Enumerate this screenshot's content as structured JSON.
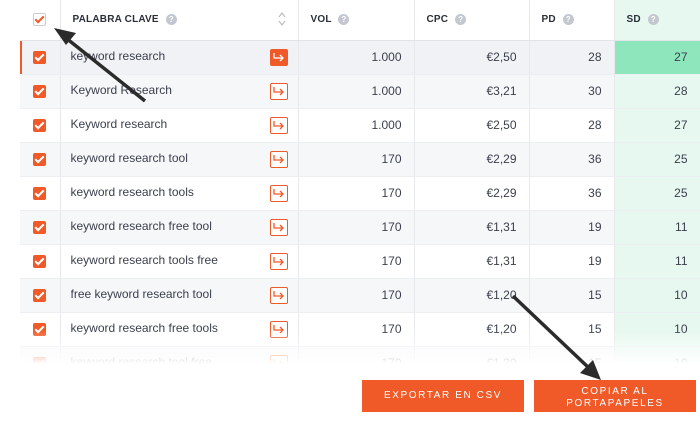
{
  "colors": {
    "accent": "#f05a28",
    "sd_highlight": "#8ee6bd",
    "sd_column": "#e6f8ef"
  },
  "table": {
    "headers": {
      "keyword": "PALABRA CLAVE",
      "vol": "VOL",
      "cpc": "CPC",
      "pd": "PD",
      "sd": "SD"
    },
    "rows": [
      {
        "keyword": "keyword research",
        "vol": "1.000",
        "cpc": "€2,50",
        "pd": "28",
        "sd": "27"
      },
      {
        "keyword": "Keyword Research",
        "vol": "1.000",
        "cpc": "€3,21",
        "pd": "30",
        "sd": "28"
      },
      {
        "keyword": "Keyword research",
        "vol": "1.000",
        "cpc": "€2,50",
        "pd": "28",
        "sd": "27"
      },
      {
        "keyword": "keyword research tool",
        "vol": "170",
        "cpc": "€2,29",
        "pd": "36",
        "sd": "25"
      },
      {
        "keyword": "keyword research tools",
        "vol": "170",
        "cpc": "€2,29",
        "pd": "36",
        "sd": "25"
      },
      {
        "keyword": "keyword research free tool",
        "vol": "170",
        "cpc": "€1,31",
        "pd": "19",
        "sd": "11"
      },
      {
        "keyword": "keyword research tools free",
        "vol": "170",
        "cpc": "€1,31",
        "pd": "19",
        "sd": "11"
      },
      {
        "keyword": "free keyword research tool",
        "vol": "170",
        "cpc": "€1,20",
        "pd": "15",
        "sd": "10"
      },
      {
        "keyword": "keyword research free tools",
        "vol": "170",
        "cpc": "€1,20",
        "pd": "15",
        "sd": "10"
      },
      {
        "keyword": "keyword research tool free",
        "vol": "170",
        "cpc": "€1,20",
        "pd": "15",
        "sd": "10"
      }
    ]
  },
  "buttons": {
    "export": "EXPORTAR EN CSV",
    "copy_line1": "COPIAR AL",
    "copy_line2": "PORTAPAPELES"
  },
  "icons": [
    "checkbox-icon",
    "help-icon",
    "sort-icon",
    "open-link-icon",
    "annotation-arrow"
  ]
}
